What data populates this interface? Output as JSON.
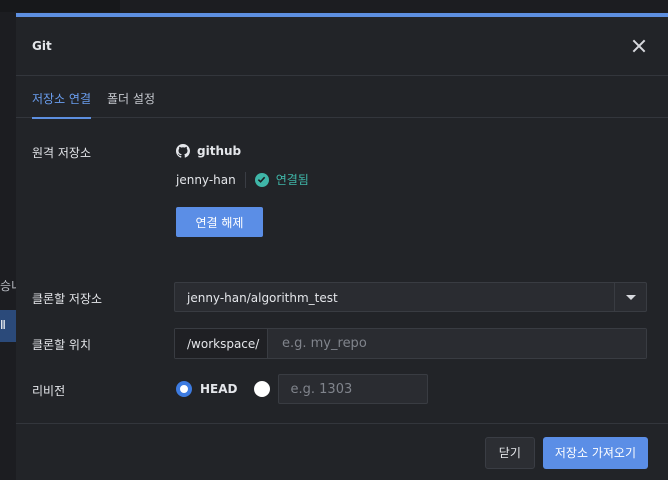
{
  "background": {
    "partial_text": "승니",
    "selected_text": "Ⅱ"
  },
  "modal": {
    "title": "Git"
  },
  "tabs": [
    {
      "label": "저장소 연결",
      "active": true
    },
    {
      "label": "폴더 설정",
      "active": false
    }
  ],
  "remote": {
    "label": "원격 저장소",
    "provider": "github",
    "user": "jenny-han",
    "status": "연결됨",
    "disconnect_label": "연결 해제"
  },
  "clone_repo": {
    "label": "클론할 저장소",
    "selected": "jenny-han/algorithm_test"
  },
  "clone_location": {
    "label": "클론할 위치",
    "prefix": "/workspace/",
    "value": "",
    "placeholder": "e.g. my_repo"
  },
  "revision": {
    "label": "리비전",
    "options": [
      {
        "label": "HEAD",
        "selected": true
      }
    ],
    "custom_value": "",
    "placeholder": "e.g. 1303"
  },
  "footer": {
    "close_label": "닫기",
    "confirm_label": "저장소 가져오기"
  },
  "colors": {
    "accent": "#5b8ee6",
    "success": "#3fb6a8",
    "background": "#222428"
  }
}
